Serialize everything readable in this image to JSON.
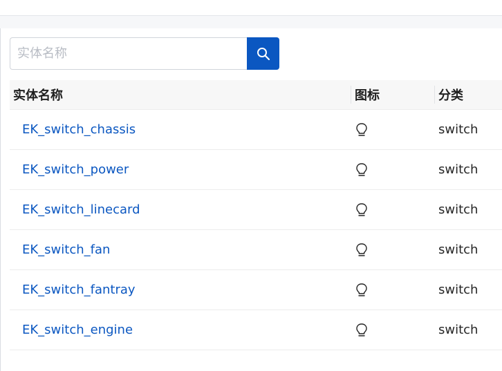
{
  "search": {
    "placeholder": "实体名称",
    "value": ""
  },
  "table": {
    "headers": {
      "name": "实体名称",
      "icon": "图标",
      "category": "分类"
    },
    "rows": [
      {
        "name": "EK_switch_chassis",
        "icon": "lightbulb-icon",
        "category": "switch"
      },
      {
        "name": "EK_switch_power",
        "icon": "lightbulb-icon",
        "category": "switch"
      },
      {
        "name": "EK_switch_linecard",
        "icon": "lightbulb-icon",
        "category": "switch"
      },
      {
        "name": "EK_switch_fan",
        "icon": "lightbulb-icon",
        "category": "switch"
      },
      {
        "name": "EK_switch_fantray",
        "icon": "lightbulb-icon",
        "category": "switch"
      },
      {
        "name": "EK_switch_engine",
        "icon": "lightbulb-icon",
        "category": "switch"
      }
    ]
  },
  "colors": {
    "accent": "#0b57c1",
    "link": "#0b57c1",
    "header_bg": "#f7f7f7"
  }
}
